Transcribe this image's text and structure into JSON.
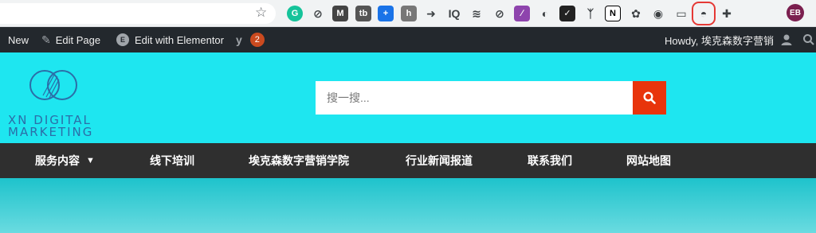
{
  "browser": {
    "extensions": [
      {
        "name": "grammarly-icon",
        "glyph": "G",
        "color": "#15c39a",
        "round": true
      },
      {
        "name": "link-icon",
        "glyph": "⊘",
        "color": "",
        "round": false
      },
      {
        "name": "gmail-icon",
        "glyph": "M",
        "color": "#444444",
        "round": false
      },
      {
        "name": "tb-icon",
        "glyph": "tb",
        "color": "#555555",
        "round": false
      },
      {
        "name": "plus-icon",
        "glyph": "+",
        "color": "#1a73e8",
        "round": false
      },
      {
        "name": "hubspot-icon",
        "glyph": "h",
        "color": "#777777",
        "round": false
      },
      {
        "name": "arrow-icon",
        "glyph": "➜",
        "color": "",
        "round": false
      },
      {
        "name": "iq-icon",
        "glyph": "IQ",
        "color": "",
        "round": false
      },
      {
        "name": "buffer-icon",
        "glyph": "≋",
        "color": "",
        "round": false
      },
      {
        "name": "compass-icon",
        "glyph": "⊘",
        "color": "",
        "round": false
      },
      {
        "name": "feather-icon",
        "glyph": "∕",
        "color": "#8e44ad",
        "round": false
      },
      {
        "name": "half-circle-icon",
        "glyph": "◐",
        "color": "",
        "round": false
      },
      {
        "name": "checkbox-icon",
        "glyph": "✓",
        "color": "#222222",
        "round": false
      },
      {
        "name": "tree-icon",
        "glyph": "ᛉ",
        "color": "",
        "round": false
      },
      {
        "name": "notion-icon",
        "glyph": "N",
        "color": "#ffffff",
        "round": false
      },
      {
        "name": "flower-icon",
        "glyph": "✿",
        "color": "",
        "round": false
      },
      {
        "name": "color-wheel-icon",
        "glyph": "◉",
        "color": "",
        "round": false
      },
      {
        "name": "tag-icon",
        "glyph": "▭",
        "color": "",
        "round": false
      },
      {
        "name": "pokeball-icon",
        "glyph": "◓",
        "color": "",
        "round": false,
        "highlighted": true
      },
      {
        "name": "puzzle-icon",
        "glyph": "✚",
        "color": "",
        "round": false
      }
    ],
    "profile_initials": "EB"
  },
  "adminbar": {
    "new_label": "New",
    "edit_page_label": "Edit Page",
    "elementor_label": "Edit with Elementor",
    "yoast_count": "2",
    "howdy_label": "Howdy, 埃克森数字营销"
  },
  "header": {
    "logo_line1": "XN DIGITAL",
    "logo_line2": "MARKETING",
    "search_placeholder": "搜一搜..."
  },
  "nav": {
    "items": [
      "服务内容",
      "线下培训",
      "埃克森数字营销学院",
      "行业新闻报道",
      "联系我们",
      "网站地图"
    ]
  }
}
